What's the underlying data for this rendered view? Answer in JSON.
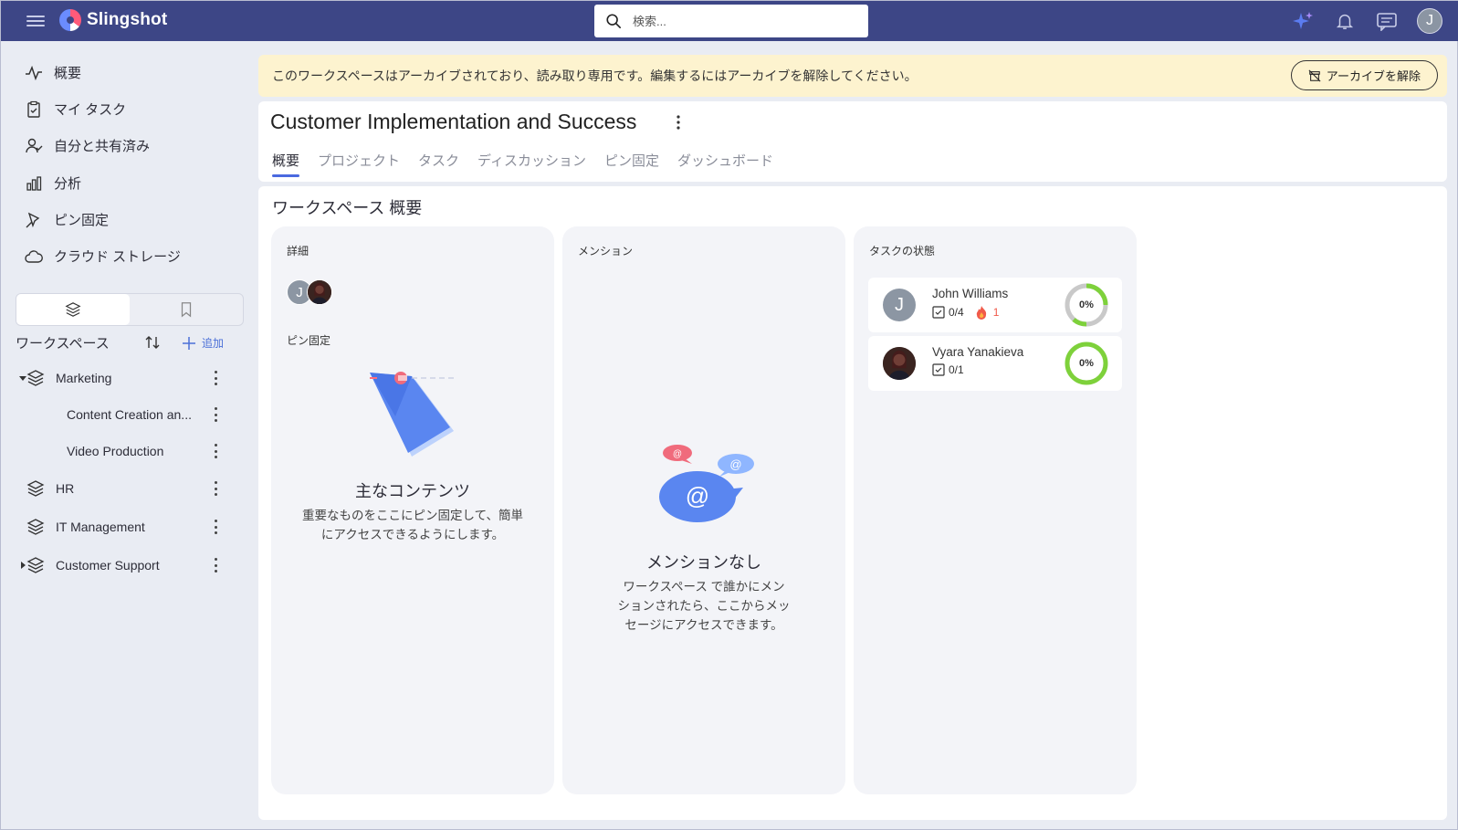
{
  "app": {
    "name": "Slingshot"
  },
  "search": {
    "placeholder": "検索..."
  },
  "sidebar": {
    "nav": [
      {
        "label": "概要",
        "icon": "activity-icon"
      },
      {
        "label": "マイ タスク",
        "icon": "clipboard-check-icon"
      },
      {
        "label": "自分と共有済み",
        "icon": "user-shared-icon"
      },
      {
        "label": "分析",
        "icon": "bar-chart-icon"
      },
      {
        "label": "ピン固定",
        "icon": "pin-icon"
      },
      {
        "label": "クラウド ストレージ",
        "icon": "cloud-icon"
      }
    ],
    "workspaces_title": "ワークスペース",
    "add_label": "追加",
    "workspaces": [
      {
        "label": "Marketing",
        "expanded": true
      },
      {
        "label": "Content Creation an...",
        "sub": true
      },
      {
        "label": "Video Production",
        "sub": true
      },
      {
        "label": "HR"
      },
      {
        "label": "IT Management"
      },
      {
        "label": "Customer Support",
        "expanded": false
      }
    ]
  },
  "banner": {
    "text": "このワークスペースはアーカイブされており、読み取り専用です。編集するにはアーカイブを解除してください。",
    "button": "アーカイブを解除"
  },
  "workspace": {
    "title": "Customer Implementation and Success",
    "tabs": [
      "概要",
      "プロジェクト",
      "タスク",
      "ディスカッション",
      "ピン固定",
      "ダッシュボード"
    ],
    "active_tab": "概要"
  },
  "overview": {
    "title": "ワークスペース 概要",
    "details": {
      "title": "詳細",
      "avatar_initial": "J",
      "pinned_label": "ピン固定",
      "empty_title": "主なコンテンツ",
      "empty_desc_line1": "重要なものをここにピン固定して、簡単",
      "empty_desc_line2": "にアクセスできるようにします。"
    },
    "mentions": {
      "title": "メンション",
      "empty_title": "メンションなし",
      "empty_desc_line1": "ワークスペース で誰かにメン",
      "empty_desc_line2": "ションされたら、ここからメッ",
      "empty_desc_line3": "セージにアクセスできます。"
    },
    "tasks": {
      "title": "タスクの状態",
      "rows": [
        {
          "name": "John Williams",
          "initial": "J",
          "tasks": "0/4",
          "overdue": "1",
          "percent": "0%"
        },
        {
          "name": "Vyara Yanakieva",
          "initial": "",
          "tasks": "0/1",
          "percent": "0%"
        }
      ]
    }
  },
  "colors": {
    "topbar": "#3d4686",
    "accent": "#4a69e0",
    "banner": "#fdf3cf",
    "donut_green": "#7ed13b",
    "donut_gray": "#c9c9c9"
  },
  "user": {
    "initial": "J"
  }
}
